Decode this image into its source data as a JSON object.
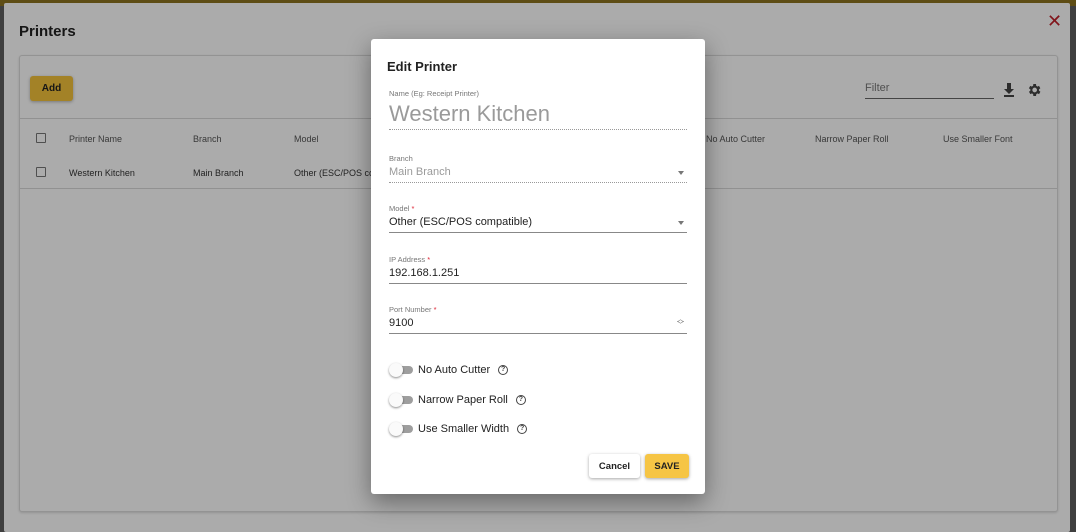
{
  "page": {
    "title": "Printers",
    "close_icon": "close-icon"
  },
  "toolbar": {
    "add_label": "Add",
    "filter_placeholder": "Filter",
    "download_icon": "download-icon",
    "settings_icon": "gear-icon"
  },
  "table": {
    "columns": [
      "Printer Name",
      "Branch",
      "Model",
      "No Auto Cutter",
      "Narrow Paper Roll",
      "Use Smaller Font"
    ],
    "rows": [
      {
        "name": "Western Kitchen",
        "branch": "Main Branch",
        "model": "Other (ESC/POS co"
      }
    ]
  },
  "dialog": {
    "title": "Edit Printer",
    "name_field": {
      "label": "Name (Eg: Receipt Printer)",
      "value": "Western Kitchen"
    },
    "branch_field": {
      "label": "Branch",
      "value": "Main Branch"
    },
    "model_field": {
      "label": "Model",
      "required": "*",
      "value": "Other (ESC/POS compatible)"
    },
    "ip_field": {
      "label": "IP Address",
      "required": "*",
      "value": "192.168.1.251"
    },
    "port_field": {
      "label": "Port Number",
      "required": "*",
      "value": "9100"
    },
    "toggles": [
      {
        "label": "No Auto Cutter",
        "on": false
      },
      {
        "label": "Narrow Paper Roll",
        "on": false
      },
      {
        "label": "Use Smaller Width",
        "on": false
      }
    ],
    "help_glyph": "?",
    "cancel_label": "Cancel",
    "save_label": "SAVE"
  }
}
